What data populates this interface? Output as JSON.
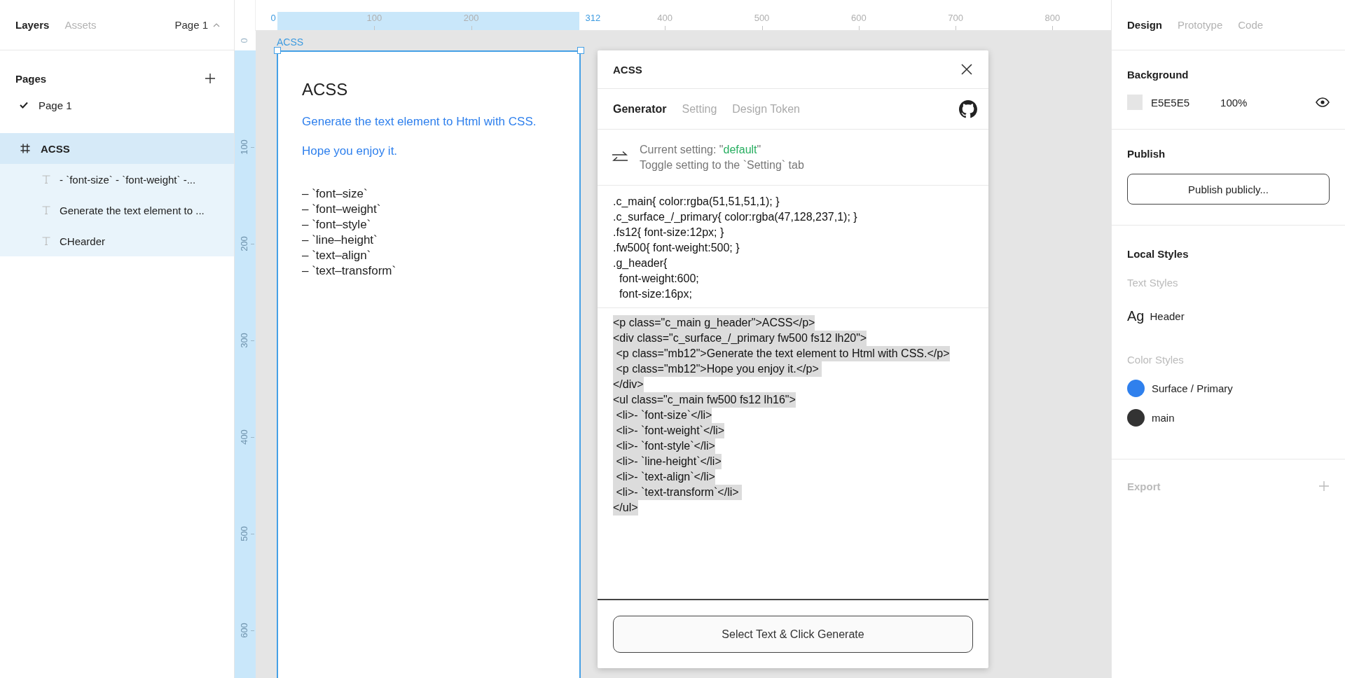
{
  "left_panel": {
    "tabs": [
      {
        "label": "Layers",
        "selected": true
      },
      {
        "label": "Assets",
        "selected": false
      }
    ],
    "page_selector": "Page 1",
    "pages_title": "Pages",
    "pages": [
      {
        "label": "Page 1",
        "selected": true
      }
    ],
    "layers": [
      {
        "name": "ACSS",
        "kind": "frame",
        "selected": true,
        "children": [
          {
            "name": "- `font-size` - `font-weight` -...",
            "kind": "text",
            "selected": false
          },
          {
            "name": "Generate the text element to ...",
            "kind": "text",
            "selected": false
          },
          {
            "name": "CHearder",
            "kind": "text",
            "selected": false
          }
        ]
      }
    ]
  },
  "canvas": {
    "ruler_x": {
      "selection_start": "0",
      "selection_end": "312",
      "ticks": [
        "100",
        "200",
        "400",
        "500",
        "600",
        "700",
        "800"
      ]
    },
    "ruler_y": {
      "selection_start": "0",
      "ticks": [
        "100",
        "200",
        "300",
        "400",
        "500",
        "600"
      ]
    },
    "frame": {
      "name": "ACSS",
      "selected": true,
      "title": "ACSS",
      "paragraphs": [
        "Generate the text element to Html with CSS.",
        "Hope you enjoy it."
      ],
      "list": [
        "– `font–size`",
        "– `font–weight`",
        "– `font–style`",
        "– `line–height`",
        "– `text–align`",
        "– `text–transform`"
      ]
    }
  },
  "plugin": {
    "title": "ACSS",
    "tabs": [
      {
        "label": "Generator",
        "selected": true
      },
      {
        "label": "Setting",
        "selected": false
      },
      {
        "label": "Design Token",
        "selected": false
      }
    ],
    "setting_prefix": "Current setting: \"",
    "setting_value": "default",
    "setting_suffix": "\"",
    "setting_hint": "Toggle setting to the `Setting` tab",
    "css_lines": [
      ".c_main{ color:rgba(51,51,51,1); }",
      ".c_surface_/_primary{ color:rgba(47,128,237,1); }",
      ".fs12{ font-size:12px; }",
      ".fw500{ font-weight:500; }",
      ".g_header{",
      "  font-weight:600;",
      "  font-size:16px;"
    ],
    "html_selected": true,
    "html_lines": [
      "<p class=\"c_main g_header\">ACSS</p>",
      "<div class=\"c_surface_/_primary fw500 fs12 lh20\">",
      " <p class=\"mb12\">Generate the text element to Html with CSS.</p>",
      " <p class=\"mb12\">Hope you enjoy it.</p> ",
      "</div>",
      "<ul class=\"c_main fw500 fs12 lh16\">",
      " <li>- `font-size`</li>",
      " <li>- `font-weight`</li>",
      " <li>- `font-style`</li>",
      " <li>- `line-height`</li>",
      " <li>- `text-align`</li>",
      " <li>- `text-transform`</li> ",
      "</ul>"
    ],
    "button": "Select Text & Click Generate"
  },
  "right_panel": {
    "tabs": [
      {
        "label": "Design",
        "selected": true
      },
      {
        "label": "Prototype",
        "selected": false
      },
      {
        "label": "Code",
        "selected": false
      }
    ],
    "background": {
      "title": "Background",
      "color": "#e5e5e5",
      "hex": "E5E5E5",
      "opacity": "100%",
      "visible": true
    },
    "publish": {
      "title": "Publish",
      "button": "Publish publicly..."
    },
    "local_styles": {
      "title": "Local Styles",
      "text_styles_label": "Text Styles",
      "text_styles": [
        {
          "sample": "Ag",
          "name": "Header"
        }
      ],
      "color_styles_label": "Color Styles",
      "color_styles": [
        {
          "name": "Surface / Primary",
          "color": "#2f80ed"
        },
        {
          "name": "main",
          "color": "#333333"
        }
      ]
    },
    "export": {
      "title": "Export",
      "disabled": true
    }
  }
}
